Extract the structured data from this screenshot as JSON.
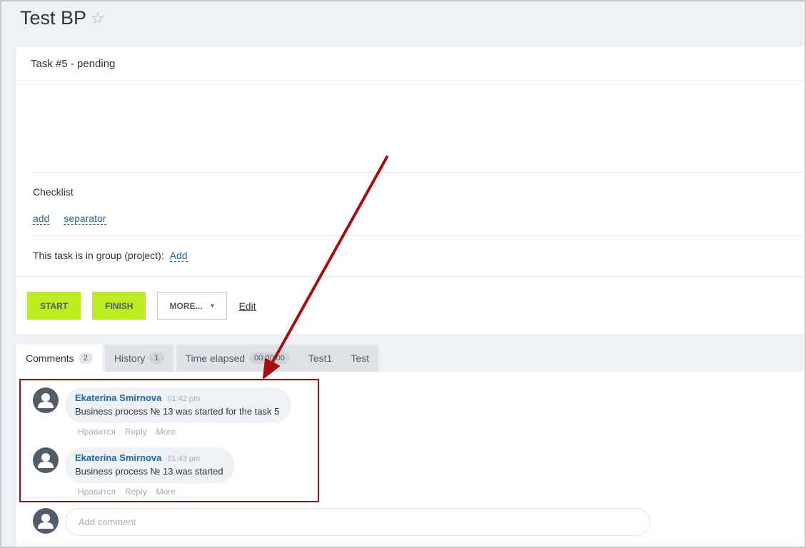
{
  "page": {
    "title": "Test BP",
    "star_glyph": "☆"
  },
  "task": {
    "header": "Task #5 - pending",
    "checklist": {
      "title": "Checklist",
      "add_label": "add",
      "separator_label": "separator"
    },
    "group": {
      "label": "This task is in group (project):",
      "add_label": "Add"
    }
  },
  "actions": {
    "start_label": "START",
    "finish_label": "FINISH",
    "more_label": "MORE...",
    "edit_label": "Edit"
  },
  "tabs": [
    {
      "label": "Comments",
      "badge": "2"
    },
    {
      "label": "History",
      "badge": "1"
    },
    {
      "label": "Time elapsed",
      "badge": "00:00:00"
    },
    {
      "label": "Test1"
    },
    {
      "label": "Test"
    }
  ],
  "comments": [
    {
      "author": "Ekaterina Smirnova",
      "time": "01:42 pm",
      "text": "Business process № 13 was started for the task 5",
      "actions": [
        "Нравится",
        "Reply",
        "More"
      ]
    },
    {
      "author": "Ekaterina Smirnova",
      "time": "01:43 pm",
      "text": "Business process № 13 was started",
      "actions": [
        "Нравится",
        "Reply",
        "More"
      ]
    }
  ],
  "add_comment": {
    "placeholder": "Add comment"
  },
  "colors": {
    "accent_green": "#bbed21",
    "link_blue": "#2067b0",
    "annotation_red": "#a60f0f"
  }
}
